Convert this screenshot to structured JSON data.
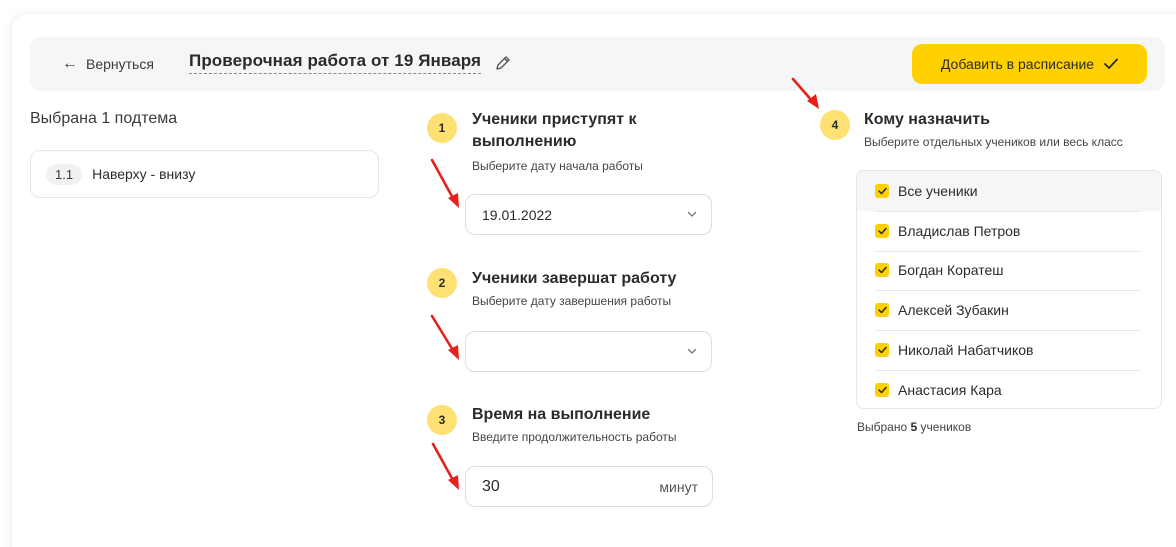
{
  "header": {
    "back_label": "Вернуться",
    "title": "Проверочная работа от 19 Января",
    "add_button_label": "Добавить в расписание"
  },
  "subtopics": {
    "heading": "Выбрана 1 подтема",
    "items": [
      {
        "number": "1.1",
        "label": "Наверху - внизу"
      }
    ]
  },
  "steps": {
    "start": {
      "number": "1",
      "title": "Ученики приступят к выполнению",
      "hint": "Выберите дату начала работы",
      "value": "19.01.2022"
    },
    "end": {
      "number": "2",
      "title": "Ученики завершат работу",
      "hint": "Выберите дату завершения работы",
      "value": ""
    },
    "duration": {
      "number": "3",
      "title": "Время на выполнение",
      "hint": "Введите продолжительность работы",
      "value": "30",
      "unit": "минут"
    },
    "assign": {
      "number": "4",
      "title": "Кому назначить",
      "hint": "Выберите отдельных учеников или весь класс"
    }
  },
  "students": {
    "all_label": "Все ученики",
    "items": [
      "Владислав Петров",
      "Богдан Коратеш",
      "Алексей Зубакин",
      "Николай Набатчиков",
      "Анастасия Кара"
    ],
    "selected_prefix": "Выбрано",
    "selected_count": "5",
    "selected_suffix": "учеников"
  },
  "colors": {
    "accent": "#ffd100",
    "badge": "#ffe173",
    "annotation_arrow": "#e8201c"
  }
}
